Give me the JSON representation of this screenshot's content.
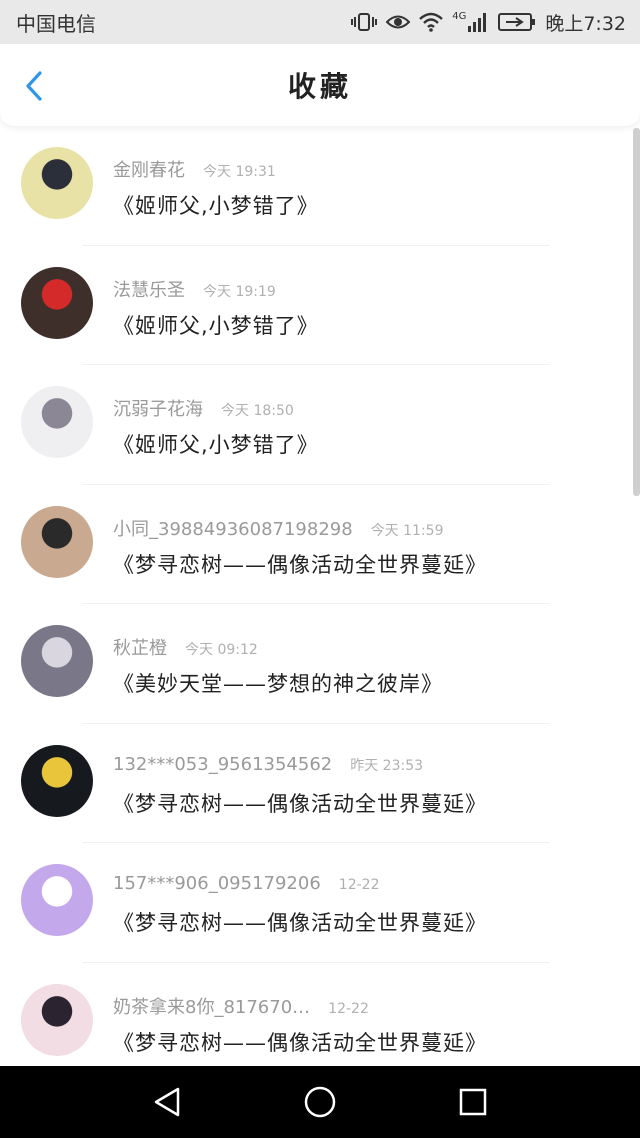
{
  "status_bar": {
    "carrier": "中国电信",
    "network": "4G",
    "time": "晚上7:32"
  },
  "header": {
    "title": "收藏",
    "back_icon": "chevron-left-icon",
    "accent_color": "#2f95e8"
  },
  "favorites": [
    {
      "name": "金刚春花",
      "time": "今天 19:31",
      "title": "《姬师父,小梦错了》",
      "avatar_color": "#e8e2a6",
      "avatar_accent": "#2a2f3a"
    },
    {
      "name": "法慧乐圣",
      "time": "今天 19:19",
      "title": "《姬师父,小梦错了》",
      "avatar_color": "#3e2f2a",
      "avatar_accent": "#d42a2a"
    },
    {
      "name": "沉弱子花海",
      "time": "今天 18:50",
      "title": "《姬师父,小梦错了》",
      "avatar_color": "#efeff2",
      "avatar_accent": "#8b8794"
    },
    {
      "name": "小同_39884936087198298",
      "time": "今天 11:59",
      "title": "《梦寻恋树——偶像活动全世界蔓延》",
      "avatar_color": "#c9a98f",
      "avatar_accent": "#2a2a2a"
    },
    {
      "name": "秋芷橙",
      "time": "今天 09:12",
      "title": "《美妙天堂——梦想的神之彼岸》",
      "avatar_color": "#7a7888",
      "avatar_accent": "#d9d6e0"
    },
    {
      "name": "132***053_9561354562",
      "time": "昨天 23:53",
      "title": "《梦寻恋树——偶像活动全世界蔓延》",
      "avatar_color": "#16191e",
      "avatar_accent": "#e8c53a"
    },
    {
      "name": "157***906_095179206",
      "time": "12-22",
      "title": "《梦寻恋树——偶像活动全世界蔓延》",
      "avatar_color": "#c4a8ec",
      "avatar_accent": "#ffffff"
    },
    {
      "name": "奶茶拿来8你_817670…",
      "time": "12-22",
      "title": "《梦寻恋树——偶像活动全世界蔓延》",
      "avatar_color": "#f1dde3",
      "avatar_accent": "#2b2430"
    }
  ],
  "nav_bar": {
    "back_icon": "triangle-back-icon",
    "home_icon": "circle-home-icon",
    "recents_icon": "square-recents-icon"
  }
}
